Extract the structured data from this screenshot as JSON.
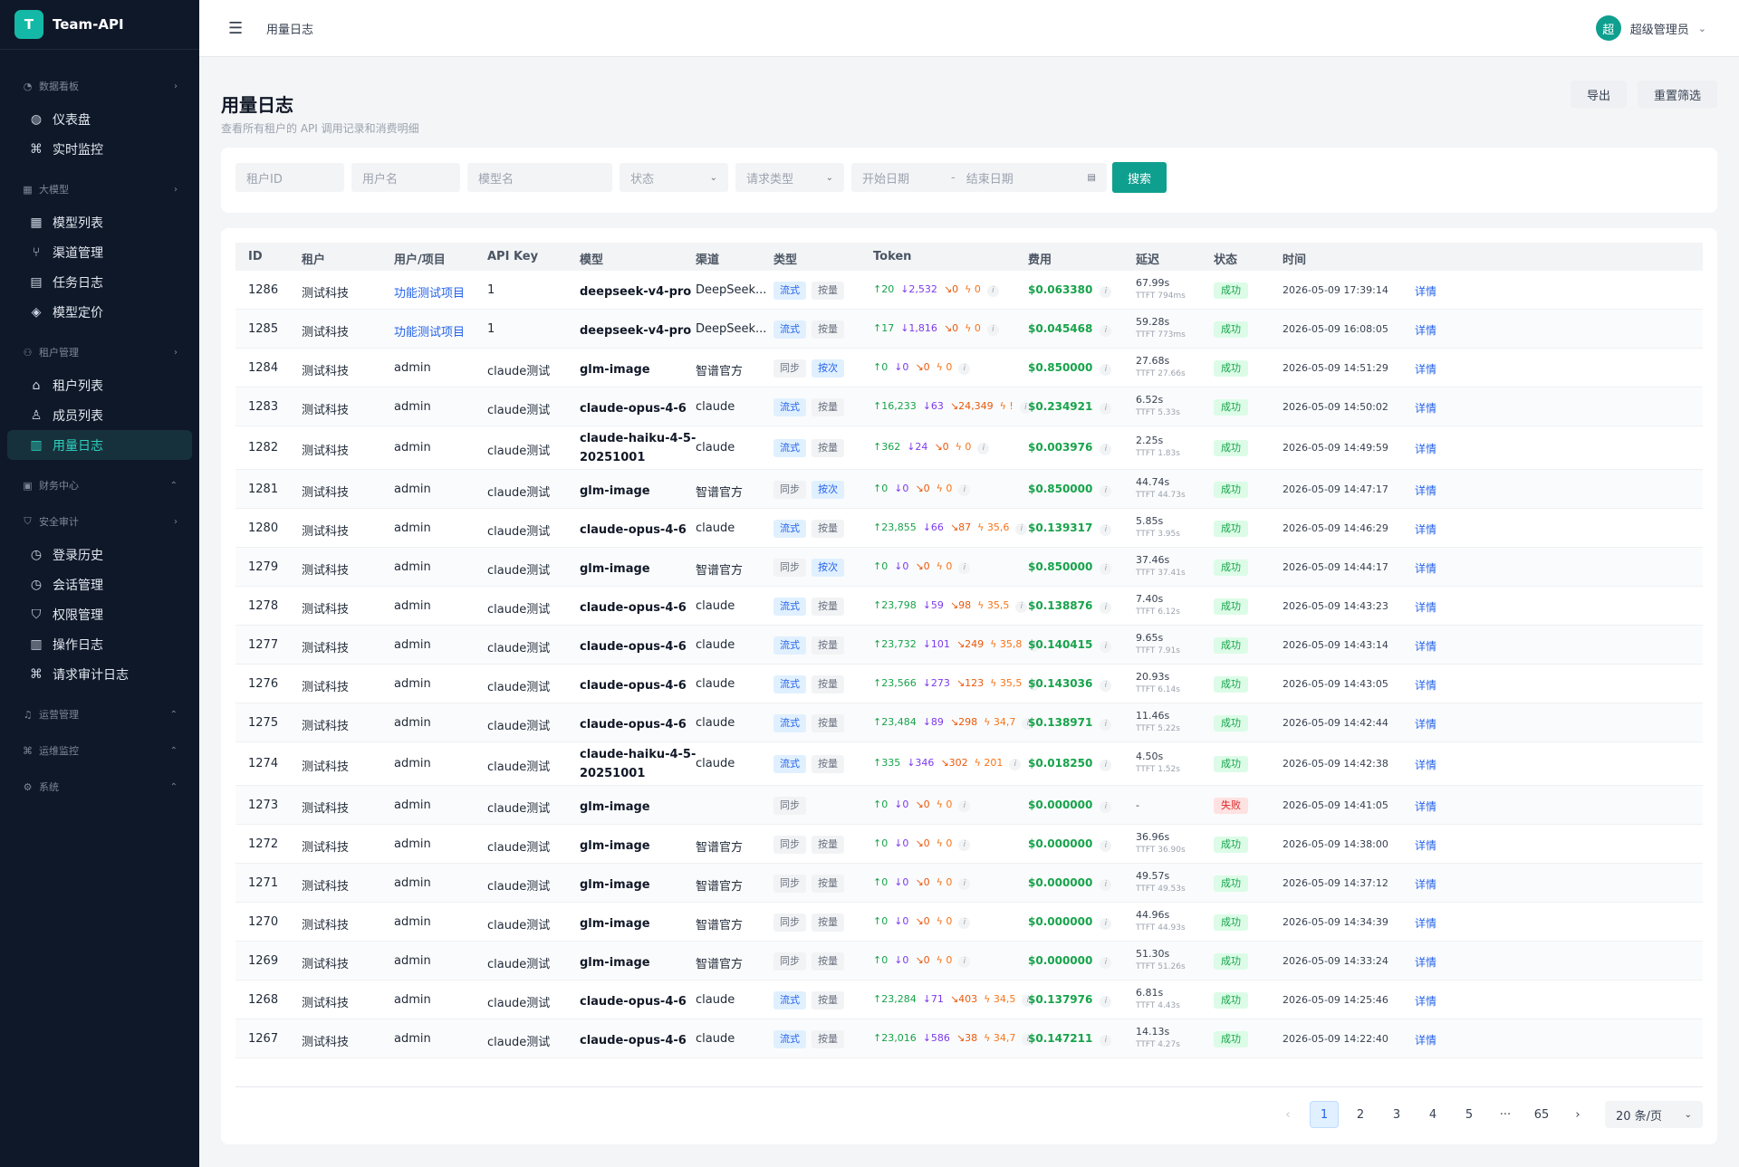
{
  "brand": {
    "logo_letter": "T",
    "name": "Team-API"
  },
  "sidebar": {
    "groups": [
      {
        "label": "数据看板",
        "icon": "dashboard-icon",
        "chevron": "›",
        "items": [
          {
            "label": "仪表盘",
            "icon": "gauge-icon"
          },
          {
            "label": "实时监控",
            "icon": "command-icon"
          }
        ]
      },
      {
        "label": "大模型",
        "icon": "grid-icon",
        "chevron": "›",
        "items": [
          {
            "label": "模型列表",
            "icon": "grid-icon"
          },
          {
            "label": "渠道管理",
            "icon": "branch-icon"
          },
          {
            "label": "任务日志",
            "icon": "calendar-icon"
          },
          {
            "label": "模型定价",
            "icon": "layers-icon"
          }
        ]
      },
      {
        "label": "租户管理",
        "icon": "users-icon",
        "chevron": "›",
        "items": [
          {
            "label": "租户列表",
            "icon": "home-icon"
          },
          {
            "label": "成员列表",
            "icon": "user-icon"
          },
          {
            "label": "用量日志",
            "icon": "document-icon"
          }
        ]
      },
      {
        "label": "财务中心",
        "icon": "wallet-icon",
        "chevron": "⌃",
        "items": []
      },
      {
        "label": "安全审计",
        "icon": "shield-icon",
        "chevron": "›",
        "items": [
          {
            "label": "登录历史",
            "icon": "clock-icon"
          },
          {
            "label": "会话管理",
            "icon": "clock-icon"
          },
          {
            "label": "权限管理",
            "icon": "shield-icon"
          },
          {
            "label": "操作日志",
            "icon": "document-icon"
          },
          {
            "label": "请求审计日志",
            "icon": "command-icon"
          }
        ]
      },
      {
        "label": "运营管理",
        "icon": "bell-icon",
        "chevron": "⌃",
        "items": []
      },
      {
        "label": "运维监控",
        "icon": "command-icon",
        "chevron": "⌃",
        "items": []
      },
      {
        "label": "系统",
        "icon": "gear-icon",
        "chevron": "⌃",
        "items": []
      }
    ]
  },
  "topbar": {
    "breadcrumb": "用量日志",
    "user_avatar": "超",
    "user_name": "超级管理员"
  },
  "header": {
    "title": "用量日志",
    "subtitle": "查看所有租户的 API 调用记录和消费明细",
    "export_label": "导出",
    "reset_label": "重置筛选"
  },
  "filters": {
    "tenant_id": "租户ID",
    "username": "用户名",
    "model": "模型名",
    "status": "状态",
    "request_type": "请求类型",
    "start_date": "开始日期",
    "date_sep": "-",
    "end_date": "结束日期",
    "search_label": "搜索"
  },
  "table": {
    "columns": [
      "ID",
      "租户",
      "用户/项目",
      "API Key",
      "模型",
      "渠道",
      "类型",
      "Token",
      "费用",
      "延迟",
      "状态",
      "时间",
      ""
    ],
    "rows": [
      {
        "id": "1286",
        "tenant": "测试科技",
        "user": "功能测试项目",
        "user_link": true,
        "key": "1",
        "model": "deepseek-v4-pro",
        "channel": "DeepSeek...",
        "mode": "流式",
        "billing": "按量",
        "tin": "↑20",
        "tout": "↓2,532",
        "tc": "↘0",
        "tr": "ϟ 0",
        "cost": "$0.063380",
        "lat": "67.99s",
        "ttft": "TTFT 794ms",
        "status": "成功",
        "ok": true,
        "time": "2026-05-09 17:39:14",
        "detail": "详情"
      },
      {
        "id": "1285",
        "tenant": "测试科技",
        "user": "功能测试项目",
        "user_link": true,
        "key": "1",
        "model": "deepseek-v4-pro",
        "channel": "DeepSeek...",
        "mode": "流式",
        "billing": "按量",
        "tin": "↑17",
        "tout": "↓1,816",
        "tc": "↘0",
        "tr": "ϟ 0",
        "cost": "$0.045468",
        "lat": "59.28s",
        "ttft": "TTFT 773ms",
        "status": "成功",
        "ok": true,
        "time": "2026-05-09 16:08:05",
        "detail": "详情"
      },
      {
        "id": "1284",
        "tenant": "测试科技",
        "user": "admin",
        "user_link": false,
        "key": "claude测试",
        "model": "glm-image",
        "channel": "智谱官方",
        "mode": "同步",
        "billing": "按次",
        "tin": "↑0",
        "tout": "↓0",
        "tc": "↘0",
        "tr": "ϟ 0",
        "cost": "$0.850000",
        "lat": "27.68s",
        "ttft": "TTFT 27.66s",
        "status": "成功",
        "ok": true,
        "time": "2026-05-09 14:51:29",
        "detail": "详情"
      },
      {
        "id": "1283",
        "tenant": "测试科技",
        "user": "admin",
        "user_link": false,
        "key": "claude测试",
        "model": "claude-opus-4-6",
        "channel": "claude",
        "mode": "流式",
        "billing": "按量",
        "tin": "↑16,233",
        "tout": "↓63",
        "tc": "↘24,349",
        "tr": "ϟ !",
        "cost": "$0.234921",
        "lat": "6.52s",
        "ttft": "TTFT 5.33s",
        "status": "成功",
        "ok": true,
        "time": "2026-05-09 14:50:02",
        "detail": "详情"
      },
      {
        "id": "1282",
        "tenant": "测试科技",
        "user": "admin",
        "user_link": false,
        "key": "claude测试",
        "model": "claude-haiku-4-5-20251001",
        "channel": "claude",
        "mode": "流式",
        "billing": "按量",
        "tin": "↑362",
        "tout": "↓24",
        "tc": "↘0",
        "tr": "ϟ 0",
        "cost": "$0.003976",
        "lat": "2.25s",
        "ttft": "TTFT 1.83s",
        "status": "成功",
        "ok": true,
        "time": "2026-05-09 14:49:59",
        "detail": "详情"
      },
      {
        "id": "1281",
        "tenant": "测试科技",
        "user": "admin",
        "user_link": false,
        "key": "claude测试",
        "model": "glm-image",
        "channel": "智谱官方",
        "mode": "同步",
        "billing": "按次",
        "tin": "↑0",
        "tout": "↓0",
        "tc": "↘0",
        "tr": "ϟ 0",
        "cost": "$0.850000",
        "lat": "44.74s",
        "ttft": "TTFT 44.73s",
        "status": "成功",
        "ok": true,
        "time": "2026-05-09 14:47:17",
        "detail": "详情"
      },
      {
        "id": "1280",
        "tenant": "测试科技",
        "user": "admin",
        "user_link": false,
        "key": "claude测试",
        "model": "claude-opus-4-6",
        "channel": "claude",
        "mode": "流式",
        "billing": "按量",
        "tin": "↑23,855",
        "tout": "↓66",
        "tc": "↘87",
        "tr": "ϟ 35,6",
        "cost": "$0.139317",
        "lat": "5.85s",
        "ttft": "TTFT 3.95s",
        "status": "成功",
        "ok": true,
        "time": "2026-05-09 14:46:29",
        "detail": "详情"
      },
      {
        "id": "1279",
        "tenant": "测试科技",
        "user": "admin",
        "user_link": false,
        "key": "claude测试",
        "model": "glm-image",
        "channel": "智谱官方",
        "mode": "同步",
        "billing": "按次",
        "tin": "↑0",
        "tout": "↓0",
        "tc": "↘0",
        "tr": "ϟ 0",
        "cost": "$0.850000",
        "lat": "37.46s",
        "ttft": "TTFT 37.41s",
        "status": "成功",
        "ok": true,
        "time": "2026-05-09 14:44:17",
        "detail": "详情"
      },
      {
        "id": "1278",
        "tenant": "测试科技",
        "user": "admin",
        "user_link": false,
        "key": "claude测试",
        "model": "claude-opus-4-6",
        "channel": "claude",
        "mode": "流式",
        "billing": "按量",
        "tin": "↑23,798",
        "tout": "↓59",
        "tc": "↘98",
        "tr": "ϟ 35,5",
        "cost": "$0.138876",
        "lat": "7.40s",
        "ttft": "TTFT 6.12s",
        "status": "成功",
        "ok": true,
        "time": "2026-05-09 14:43:23",
        "detail": "详情"
      },
      {
        "id": "1277",
        "tenant": "测试科技",
        "user": "admin",
        "user_link": false,
        "key": "claude测试",
        "model": "claude-opus-4-6",
        "channel": "claude",
        "mode": "流式",
        "billing": "按量",
        "tin": "↑23,732",
        "tout": "↓101",
        "tc": "↘249",
        "tr": "ϟ 35,8",
        "cost": "$0.140415",
        "lat": "9.65s",
        "ttft": "TTFT 7.91s",
        "status": "成功",
        "ok": true,
        "time": "2026-05-09 14:43:14",
        "detail": "详情"
      },
      {
        "id": "1276",
        "tenant": "测试科技",
        "user": "admin",
        "user_link": false,
        "key": "claude测试",
        "model": "claude-opus-4-6",
        "channel": "claude",
        "mode": "流式",
        "billing": "按量",
        "tin": "↑23,566",
        "tout": "↓273",
        "tc": "↘123",
        "tr": "ϟ 35,5",
        "cost": "$0.143036",
        "lat": "20.93s",
        "ttft": "TTFT 6.14s",
        "status": "成功",
        "ok": true,
        "time": "2026-05-09 14:43:05",
        "detail": "详情"
      },
      {
        "id": "1275",
        "tenant": "测试科技",
        "user": "admin",
        "user_link": false,
        "key": "claude测试",
        "model": "claude-opus-4-6",
        "channel": "claude",
        "mode": "流式",
        "billing": "按量",
        "tin": "↑23,484",
        "tout": "↓89",
        "tc": "↘298",
        "tr": "ϟ 34,7",
        "cost": "$0.138971",
        "lat": "11.46s",
        "ttft": "TTFT 5.22s",
        "status": "成功",
        "ok": true,
        "time": "2026-05-09 14:42:44",
        "detail": "详情"
      },
      {
        "id": "1274",
        "tenant": "测试科技",
        "user": "admin",
        "user_link": false,
        "key": "claude测试",
        "model": "claude-haiku-4-5-20251001",
        "channel": "claude",
        "mode": "流式",
        "billing": "按量",
        "tin": "↑335",
        "tout": "↓346",
        "tc": "↘302",
        "tr": "ϟ 201",
        "cost": "$0.018250",
        "lat": "4.50s",
        "ttft": "TTFT 1.52s",
        "status": "成功",
        "ok": true,
        "time": "2026-05-09 14:42:38",
        "detail": "详情"
      },
      {
        "id": "1273",
        "tenant": "测试科技",
        "user": "admin",
        "user_link": false,
        "key": "claude测试",
        "model": "glm-image",
        "channel": "",
        "mode": "同步",
        "billing": "",
        "tin": "↑0",
        "tout": "↓0",
        "tc": "↘0",
        "tr": "ϟ 0",
        "cost": "$0.000000",
        "lat": "-",
        "ttft": "",
        "status": "失败",
        "ok": false,
        "time": "2026-05-09 14:41:05",
        "detail": "详情"
      },
      {
        "id": "1272",
        "tenant": "测试科技",
        "user": "admin",
        "user_link": false,
        "key": "claude测试",
        "model": "glm-image",
        "channel": "智谱官方",
        "mode": "同步",
        "billing": "按量",
        "tin": "↑0",
        "tout": "↓0",
        "tc": "↘0",
        "tr": "ϟ 0",
        "cost": "$0.000000",
        "lat": "36.96s",
        "ttft": "TTFT 36.90s",
        "status": "成功",
        "ok": true,
        "time": "2026-05-09 14:38:00",
        "detail": "详情"
      },
      {
        "id": "1271",
        "tenant": "测试科技",
        "user": "admin",
        "user_link": false,
        "key": "claude测试",
        "model": "glm-image",
        "channel": "智谱官方",
        "mode": "同步",
        "billing": "按量",
        "tin": "↑0",
        "tout": "↓0",
        "tc": "↘0",
        "tr": "ϟ 0",
        "cost": "$0.000000",
        "lat": "49.57s",
        "ttft": "TTFT 49.53s",
        "status": "成功",
        "ok": true,
        "time": "2026-05-09 14:37:12",
        "detail": "详情"
      },
      {
        "id": "1270",
        "tenant": "测试科技",
        "user": "admin",
        "user_link": false,
        "key": "claude测试",
        "model": "glm-image",
        "channel": "智谱官方",
        "mode": "同步",
        "billing": "按量",
        "tin": "↑0",
        "tout": "↓0",
        "tc": "↘0",
        "tr": "ϟ 0",
        "cost": "$0.000000",
        "lat": "44.96s",
        "ttft": "TTFT 44.93s",
        "status": "成功",
        "ok": true,
        "time": "2026-05-09 14:34:39",
        "detail": "详情"
      },
      {
        "id": "1269",
        "tenant": "测试科技",
        "user": "admin",
        "user_link": false,
        "key": "claude测试",
        "model": "glm-image",
        "channel": "智谱官方",
        "mode": "同步",
        "billing": "按量",
        "tin": "↑0",
        "tout": "↓0",
        "tc": "↘0",
        "tr": "ϟ 0",
        "cost": "$0.000000",
        "lat": "51.30s",
        "ttft": "TTFT 51.26s",
        "status": "成功",
        "ok": true,
        "time": "2026-05-09 14:33:24",
        "detail": "详情"
      },
      {
        "id": "1268",
        "tenant": "测试科技",
        "user": "admin",
        "user_link": false,
        "key": "claude测试",
        "model": "claude-opus-4-6",
        "channel": "claude",
        "mode": "流式",
        "billing": "按量",
        "tin": "↑23,284",
        "tout": "↓71",
        "tc": "↘403",
        "tr": "ϟ 34,5",
        "cost": "$0.137976",
        "lat": "6.81s",
        "ttft": "TTFT 4.43s",
        "status": "成功",
        "ok": true,
        "time": "2026-05-09 14:25:46",
        "detail": "详情"
      },
      {
        "id": "1267",
        "tenant": "测试科技",
        "user": "admin",
        "user_link": false,
        "key": "claude测试",
        "model": "claude-opus-4-6",
        "channel": "claude",
        "mode": "流式",
        "billing": "按量",
        "tin": "↑23,016",
        "tout": "↓586",
        "tc": "↘38",
        "tr": "ϟ 34,7",
        "cost": "$0.147211",
        "lat": "14.13s",
        "ttft": "TTFT 4.27s",
        "status": "成功",
        "ok": true,
        "time": "2026-05-09 14:22:40",
        "detail": "详情"
      }
    ]
  },
  "pagination": {
    "prev": "‹",
    "pages": [
      "1",
      "2",
      "3",
      "4",
      "5",
      "···",
      "65"
    ],
    "current": "1",
    "next": "›",
    "page_size": "20 条/页"
  }
}
